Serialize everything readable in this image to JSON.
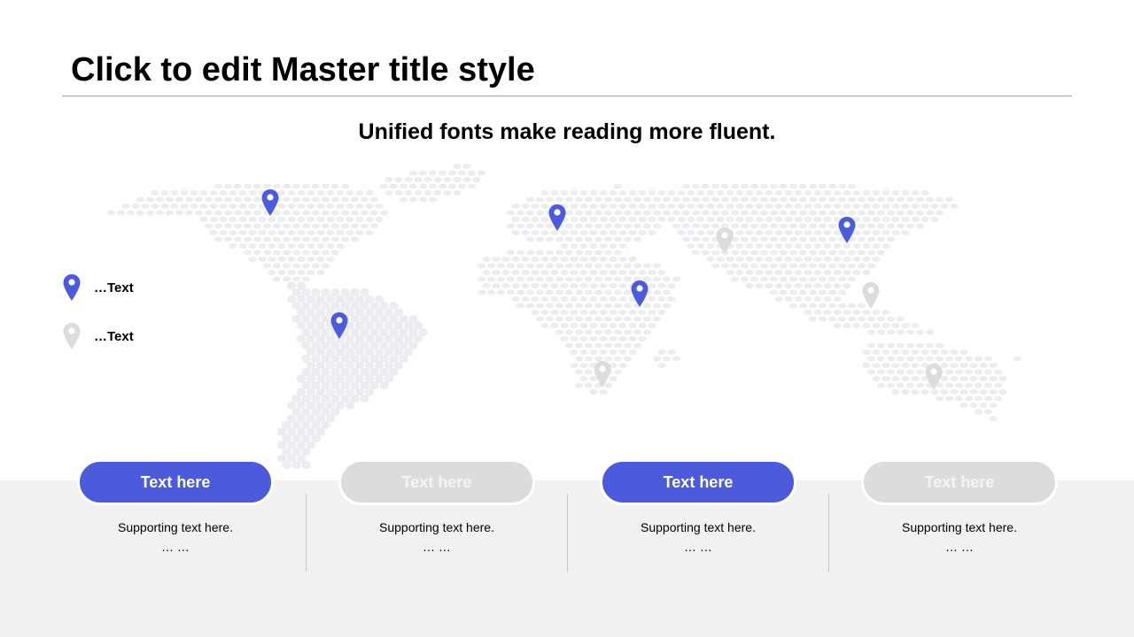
{
  "slide": {
    "title": "Click to edit Master title style",
    "subtitle": "Unified fonts make reading more fluent."
  },
  "colors": {
    "accent": "#4b5bdc",
    "muted": "#dcdcdc",
    "map_dot": "#ebedf0",
    "band": "#f1f1f1"
  },
  "legend": [
    {
      "label": "…Text",
      "icon": "map-pin-icon",
      "color": "#4b5bdc"
    },
    {
      "label": "…Text",
      "icon": "map-pin-icon",
      "color": "#dcdcdc"
    }
  ],
  "columns": [
    {
      "button_label": "Text here",
      "state": "active",
      "support": "Supporting text here.",
      "ellipsis": "… …"
    },
    {
      "button_label": "Text here",
      "state": "inactive",
      "support": "Supporting text here.",
      "ellipsis": "… …"
    },
    {
      "button_label": "Text here",
      "state": "active",
      "support": "Supporting text here.",
      "ellipsis": "… …"
    },
    {
      "button_label": "Text here",
      "state": "inactive",
      "support": "Supporting text here.",
      "ellipsis": "… …"
    }
  ]
}
